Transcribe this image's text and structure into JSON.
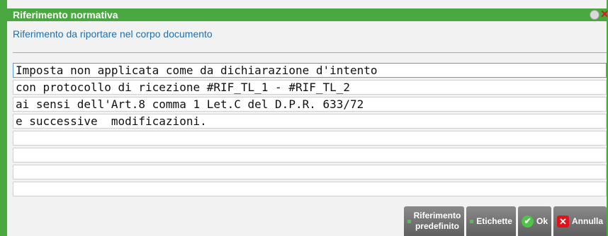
{
  "window": {
    "title": "Riferimento normativa",
    "subtitle": "Riferimento da riportare nel corpo documento"
  },
  "lines": [
    "Imposta non applicata come da dichiarazione d'intento",
    "con protocollo di ricezione #RIF_TL_1 - #RIF_TL_2",
    "ai sensi dell'Art.8 comma 1 Let.C del D.P.R. 633/72",
    "e successive  modificazioni.",
    "",
    "",
    "",
    ""
  ],
  "buttons": {
    "riferimento_line1": "Riferimento",
    "riferimento_line2": "predefinito",
    "etichette": "Etichette",
    "ok": "Ok",
    "annulla": "Annulla"
  },
  "colors": {
    "accent": "#49a83f",
    "subtitle": "#1f6fb1",
    "close": "#e0131b"
  }
}
